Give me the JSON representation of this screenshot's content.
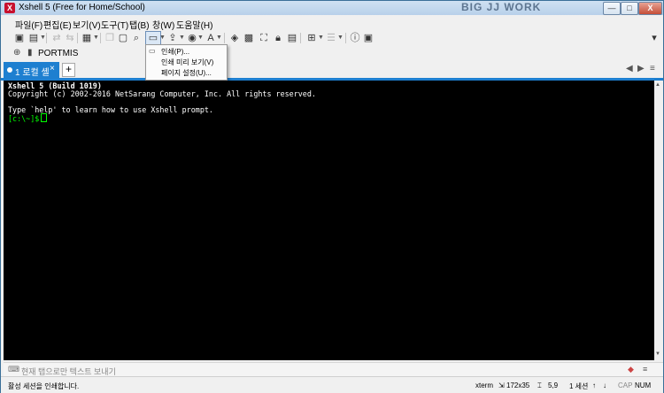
{
  "window": {
    "title": "Xshell 5 (Free for Home/School)",
    "app_icon": "X",
    "background_text": "BIG JJ WORK",
    "minimize": "—",
    "maximize": "□",
    "close": "X"
  },
  "menubar": {
    "items": [
      "파일(F)",
      "편집(E)",
      "보기(V)",
      "도구(T)",
      "탭(B)",
      "창(W)",
      "도움말(H)"
    ]
  },
  "toolbar": {
    "icons": [
      "new-session-icon",
      "open-folder-icon",
      "reconnect-icon",
      "disconnect-icon",
      "properties-icon",
      "copy-icon",
      "paste-icon",
      "find-icon",
      "print-icon",
      "file-transfer-icon",
      "globe-icon",
      "font-icon",
      "script-icon",
      "lock-icon",
      "compose-icon",
      "tile-icon",
      "help-icon",
      "fullscreen-icon"
    ]
  },
  "address": {
    "session_name": "PORTMIS"
  },
  "tabs": [
    {
      "label": "1 로컬 셸",
      "close": "×"
    }
  ],
  "tab_add": "+",
  "tab_nav": {
    "prev": "◀",
    "next": "▶",
    "menu": "≡"
  },
  "terminal": {
    "lines": [
      "Xshell 5 (Build 1019)",
      "Copyright (c) 2002-2016 NetSarang Computer, Inc. All rights reserved.",
      "",
      "Type `help' to learn how to use Xshell prompt.",
      "[c:\\~]$ "
    ],
    "prompt": "[c:\\~]$"
  },
  "print_menu": {
    "items": [
      "인쇄(P)...",
      "인쇄 미리 보기(V)",
      "페이지 설정(U)..."
    ]
  },
  "compose_bar": {
    "placeholder": "현재 탭으로만 텍스트 보내기"
  },
  "statusbar": {
    "message": "활성 세션을 인쇄합니다.",
    "terminal_type": "xterm",
    "size": "172x35",
    "cursor_pos": "5,9",
    "sessions": "1 세션",
    "cap": "CAP",
    "num": "NUM"
  },
  "colors": {
    "tab_accent": "#1e7fd0",
    "terminal_bg": "#000000",
    "prompt_green": "#00ff00"
  }
}
